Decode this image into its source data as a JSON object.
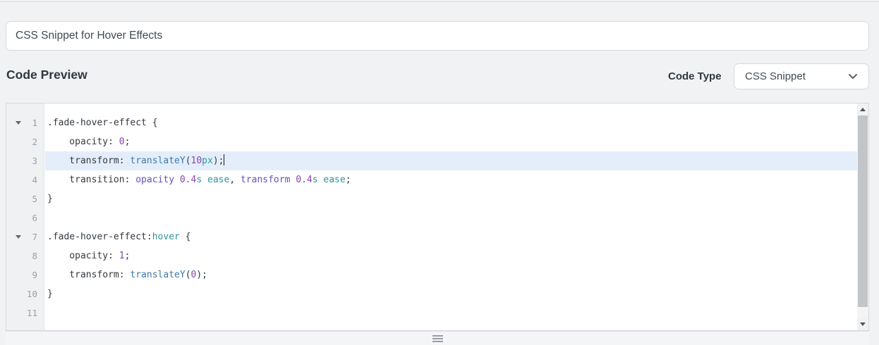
{
  "title_input": {
    "value": "CSS Snippet for Hover Effects"
  },
  "section": {
    "heading": "Code Preview",
    "code_type_label": "Code Type",
    "code_type_selected": "CSS Snippet"
  },
  "colors": {
    "page_bg": "#f0f2f4",
    "active_line_bg": "#e4eefb",
    "gutter_bg": "#f0f1f2",
    "line_number": "#9ba1a7"
  },
  "editor": {
    "language": "css",
    "active_line": 3,
    "syntax_colors": {
      "d": "#343a40",
      "n": "#8a44ad",
      "t": "#2f969b",
      "f": "#4178a8",
      "v": "#6152bd"
    },
    "lines": [
      {
        "n": 1,
        "fold": true,
        "tokens": [
          [
            ".fade-hover-effect {",
            "d"
          ]
        ]
      },
      {
        "n": 2,
        "tokens": [
          [
            "    opacity: ",
            "d"
          ],
          [
            "0",
            "n"
          ],
          [
            ";",
            "d"
          ]
        ]
      },
      {
        "n": 3,
        "caret": true,
        "tokens": [
          [
            "    transform: ",
            "d"
          ],
          [
            "translateY",
            "f"
          ],
          [
            "(",
            "d"
          ],
          [
            "10",
            "n"
          ],
          [
            "px",
            "t"
          ],
          [
            ");",
            "d"
          ]
        ]
      },
      {
        "n": 4,
        "tokens": [
          [
            "    transition: ",
            "d"
          ],
          [
            "opacity",
            "v"
          ],
          [
            " ",
            "d"
          ],
          [
            "0.4",
            "n"
          ],
          [
            "s",
            "t"
          ],
          [
            " ",
            "d"
          ],
          [
            "ease",
            "t"
          ],
          [
            ", ",
            "d"
          ],
          [
            "transform",
            "v"
          ],
          [
            " ",
            "d"
          ],
          [
            "0.4",
            "n"
          ],
          [
            "s",
            "t"
          ],
          [
            " ",
            "d"
          ],
          [
            "ease",
            "t"
          ],
          [
            ";",
            "d"
          ]
        ]
      },
      {
        "n": 5,
        "tokens": [
          [
            "}",
            "d"
          ]
        ]
      },
      {
        "n": 6,
        "tokens": []
      },
      {
        "n": 7,
        "fold": true,
        "tokens": [
          [
            ".fade-hover-effect",
            "d"
          ],
          [
            ":",
            "d"
          ],
          [
            "hover",
            "t"
          ],
          [
            " {",
            "d"
          ]
        ]
      },
      {
        "n": 8,
        "tokens": [
          [
            "    opacity: ",
            "d"
          ],
          [
            "1",
            "n"
          ],
          [
            ";",
            "d"
          ]
        ]
      },
      {
        "n": 9,
        "tokens": [
          [
            "    transform: ",
            "d"
          ],
          [
            "translateY",
            "f"
          ],
          [
            "(",
            "d"
          ],
          [
            "0",
            "n"
          ],
          [
            ");",
            "d"
          ]
        ]
      },
      {
        "n": 10,
        "tokens": [
          [
            "}",
            "d"
          ]
        ]
      },
      {
        "n": 11,
        "tokens": []
      }
    ]
  }
}
